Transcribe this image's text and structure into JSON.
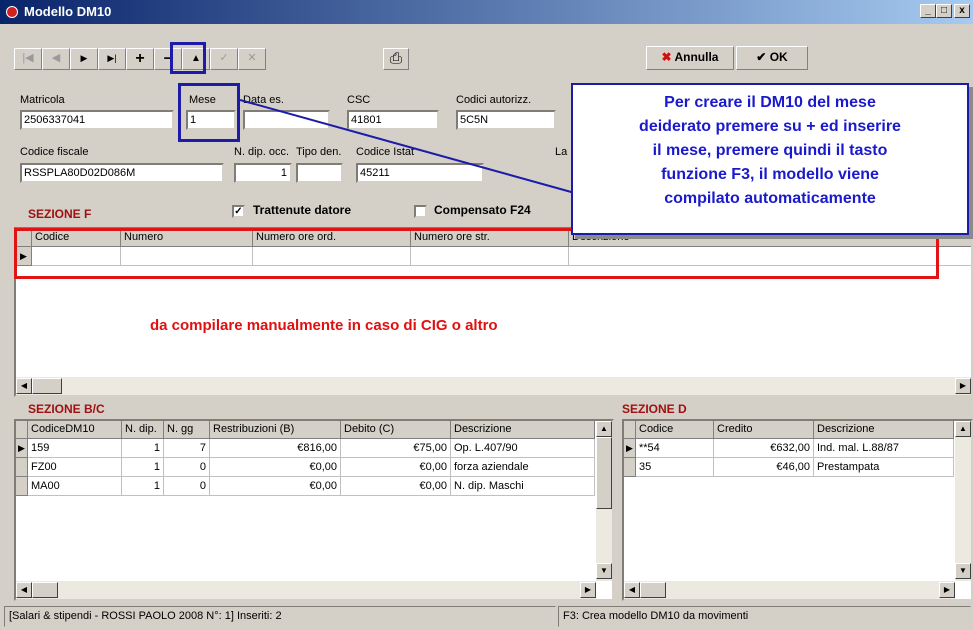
{
  "window": {
    "title": "Modello DM10",
    "min": "_",
    "max": "□",
    "close": "x"
  },
  "toolbar": {
    "first": "|◀",
    "prev": "◀",
    "next": "▶",
    "last": "▶|",
    "add": "+",
    "delete": "−",
    "up": "▲",
    "confirm": "✓",
    "cancel_x": "✕",
    "print": "⎙",
    "annulla_icon": "✖",
    "annulla": "Annulla",
    "ok_icon": "✔",
    "ok": "OK"
  },
  "fields": {
    "matricola_label": "Matricola",
    "matricola": "2506337041",
    "mese_label": "Mese",
    "mese": "1",
    "data_es_label": "Data es.",
    "data_es": "",
    "csc_label": "CSC",
    "csc": "41801",
    "codici_autorizz_label": "Codici autorizz.",
    "codici_autorizz": "5C5N",
    "codice_fiscale_label": "Codice fiscale",
    "codice_fiscale": "RSSPLA80D02D086M",
    "n_dip_occ_label": "N. dip. occ.",
    "n_dip_occ": "1",
    "tipo_den_label": "Tipo den.",
    "tipo_den": "",
    "codice_istat_label": "Codice Istat",
    "codice_istat": "45211",
    "la_label": "La"
  },
  "checks": {
    "trattenute": "Trattenute datore",
    "trattenute_checked": "✓",
    "compensato": "Compensato F24"
  },
  "sezione_f": {
    "title": "SEZIONE F",
    "columns": [
      "Codice",
      "Numero",
      "Numero ore ord.",
      "Numero ore str.",
      "Descrizione"
    ],
    "indicator": "▶"
  },
  "sezione_bc": {
    "title": "SEZIONE B/C",
    "columns": [
      "CodiceDM10",
      "N. dip.",
      "N. gg",
      "Restribuzioni (B)",
      "Debito (C)",
      "Descrizione"
    ],
    "rows": [
      [
        "159",
        "1",
        "7",
        "€816,00",
        "€75,00",
        "Op. L.407/90"
      ],
      [
        "FZ00",
        "1",
        "0",
        "€0,00",
        "€0,00",
        "forza aziendale"
      ],
      [
        "MA00",
        "1",
        "0",
        "€0,00",
        "€0,00",
        "N. dip. Maschi"
      ]
    ],
    "indicator": "▶"
  },
  "sezione_d": {
    "title": "SEZIONE D",
    "columns": [
      "Codice",
      "Credito",
      "Descrizione"
    ],
    "rows": [
      [
        "**54",
        "€632,00",
        "Ind. mal. L.88/87"
      ],
      [
        "35",
        "€46,00",
        "Prestampata"
      ]
    ],
    "indicator": "▶"
  },
  "annotations": {
    "callout_lines": [
      "Per creare il DM10 del mese",
      "deiderato premere su + ed inserire",
      "il mese, premere quindi il tasto",
      "funzione F3, il modello viene",
      "compilato automaticamente"
    ],
    "note": "da compilare manualmente in caso di CIG o altro"
  },
  "status": {
    "left": "[Salari & stipendi - ROSSI PAOLO 2008 N°: 1] Inseriti: 2",
    "right": "F3: Crea modello DM10 da movimenti"
  },
  "scroll": {
    "left": "◀",
    "right": "▶",
    "up": "▲",
    "down": "▼"
  },
  "colors": {
    "title_start": "#0a246a",
    "title_end": "#a6caf0",
    "section": "#a01010",
    "annotation_blue": "#1a1acc",
    "annotation_red": "#e01010"
  }
}
